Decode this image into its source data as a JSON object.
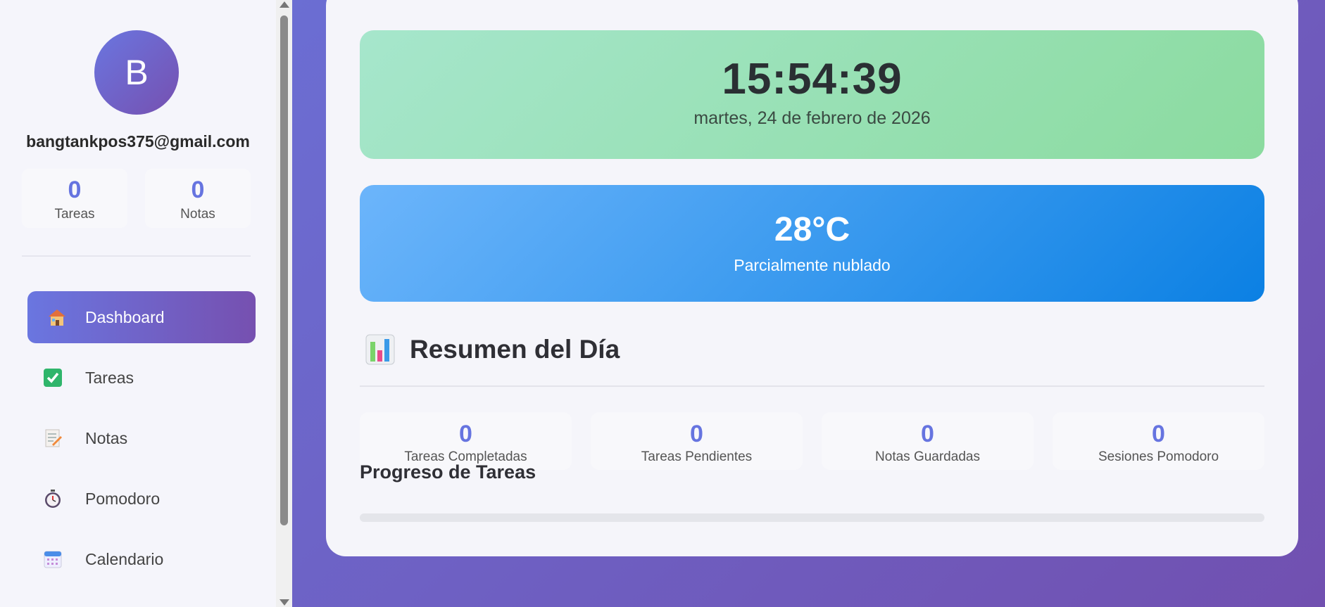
{
  "user": {
    "initial": "B",
    "email": "bangtankpos375@gmail.com"
  },
  "sidebar_stats": [
    {
      "value": "0",
      "label": "Tareas"
    },
    {
      "value": "0",
      "label": "Notas"
    }
  ],
  "nav": [
    {
      "label": "Dashboard",
      "icon": "house-icon",
      "active": true
    },
    {
      "label": "Tareas",
      "icon": "check-box-icon",
      "active": false
    },
    {
      "label": "Notas",
      "icon": "memo-icon",
      "active": false
    },
    {
      "label": "Pomodoro",
      "icon": "stopwatch-icon",
      "active": false
    },
    {
      "label": "Calendario",
      "icon": "calendar-icon",
      "active": false
    }
  ],
  "clock": {
    "time": "15:54:39",
    "date": "martes, 24 de febrero de 2026"
  },
  "weather": {
    "temp": "28°C",
    "description": "Parcialmente nublado"
  },
  "summary": {
    "title": "Resumen del Día",
    "icon": "bar-chart-icon",
    "stats": [
      {
        "value": "0",
        "label": "Tareas Completadas"
      },
      {
        "value": "0",
        "label": "Tareas Pendientes"
      },
      {
        "value": "0",
        "label": "Notas Guardadas"
      },
      {
        "value": "0",
        "label": "Sesiones Pomodoro"
      }
    ]
  },
  "progress": {
    "title": "Progreso de Tareas",
    "percent": 0
  },
  "colors": {
    "accent": "#6674e0",
    "accent_dark": "#7650b0",
    "clock_bg": "#8bdb9f",
    "weather_bg": "#0b80e3"
  }
}
